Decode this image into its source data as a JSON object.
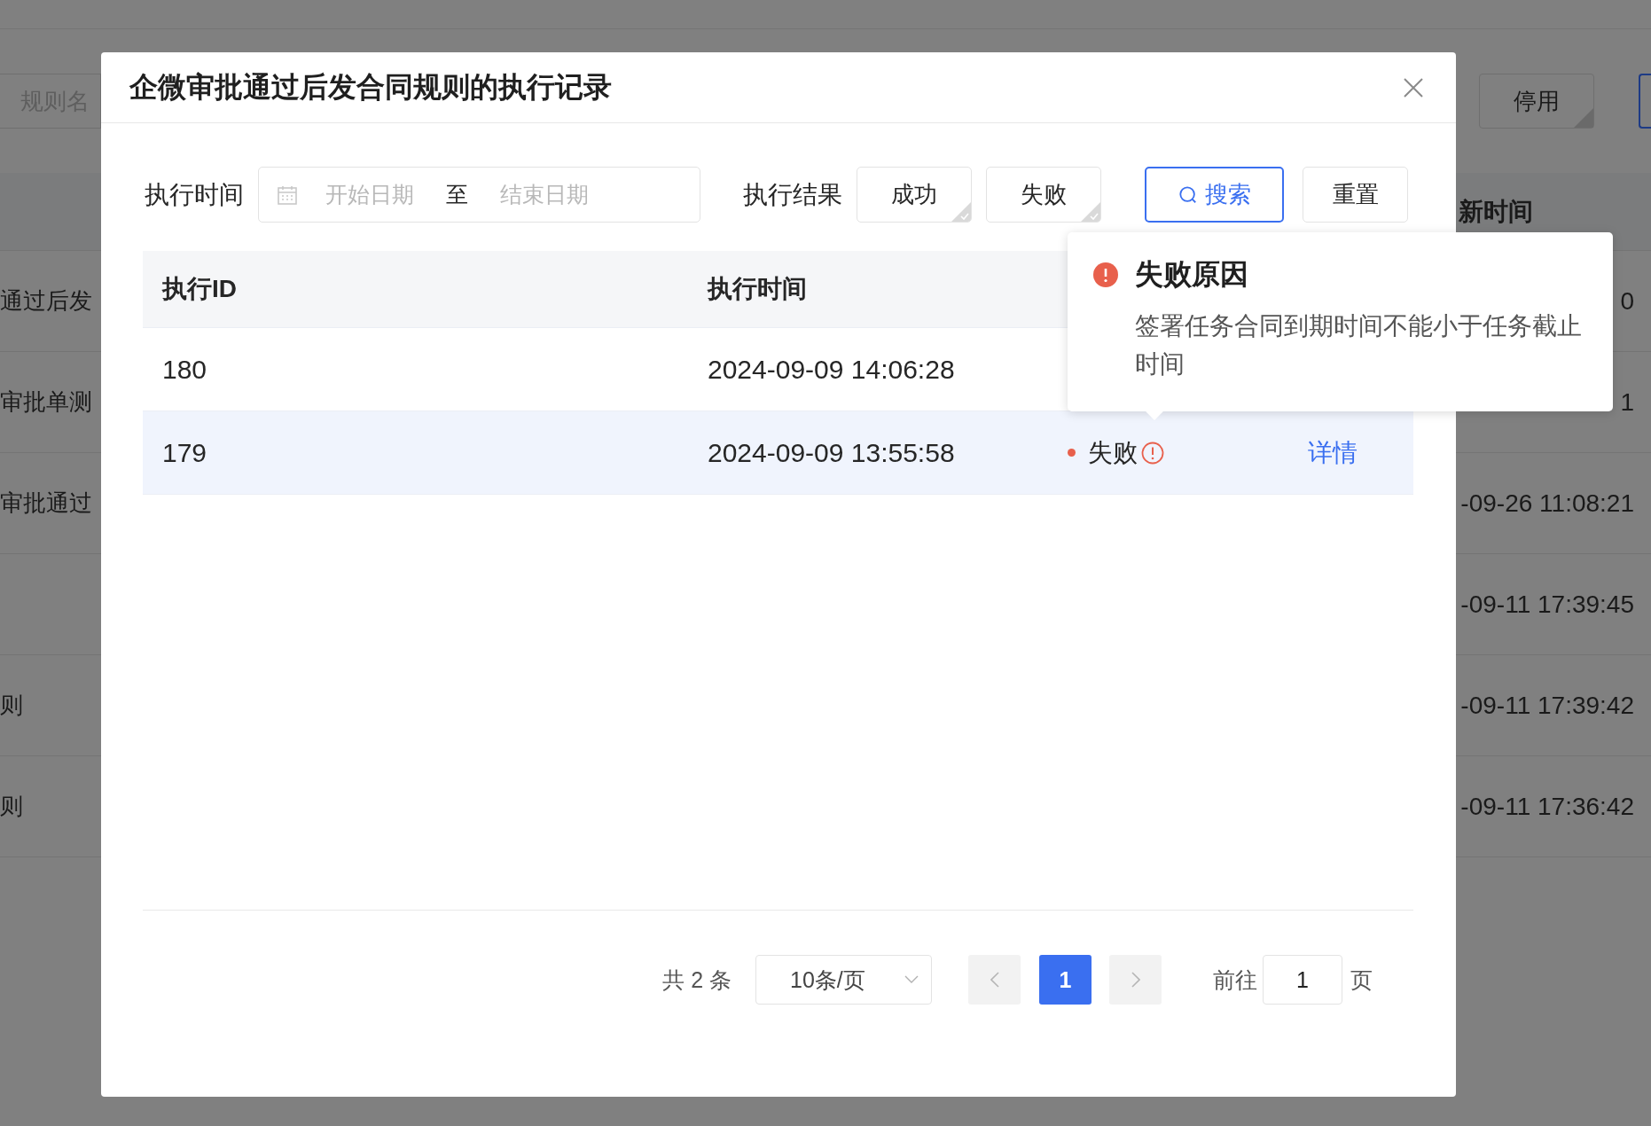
{
  "background_page": {
    "search_placeholder": "规则名",
    "buttons": [
      {
        "label": "停用",
        "kind": "default"
      },
      {
        "kind": "primary"
      }
    ],
    "table": {
      "column_header": "新时间",
      "rows": [
        {
          "column_1": "通过后发",
          "column_2": "0"
        },
        {
          "column_1": "审批单测",
          "column_2": "1"
        },
        {
          "column_1": "审批通过",
          "column_2": "-09-26 11:08:21"
        },
        {
          "column_1": "",
          "column_2": "-09-11 17:39:45"
        },
        {
          "column_1": "则",
          "column_2": "-09-11 17:39:42"
        },
        {
          "column_1": "则",
          "column_2": "-09-11 17:36:42"
        }
      ]
    }
  },
  "dialog": {
    "title": "企微审批通过后发合同规则的执行记录",
    "filters": {
      "time_label": "执行时间",
      "date_range": {
        "start_placeholder": "开始日期",
        "separator": "至",
        "end_placeholder": "结束日期"
      },
      "result_label": "执行结果",
      "result_options": [
        {
          "label": "成功",
          "selected": false
        },
        {
          "label": "失败",
          "selected": false
        }
      ],
      "search_button": "搜索",
      "reset_button": "重置"
    },
    "table": {
      "columns": [
        "执行ID",
        "执行时间"
      ],
      "rows": [
        {
          "id": "180",
          "time": "2024-09-09 14:06:28",
          "hovered": false
        },
        {
          "id": "179",
          "time": "2024-09-09 13:55:58",
          "hovered": true,
          "status": {
            "kind": "failure",
            "label": "失败"
          },
          "action": "详情"
        }
      ]
    },
    "pagination": {
      "total": "共 2 条",
      "page_size": "10条/页",
      "pages": [
        {
          "label": "1",
          "selected": true
        }
      ],
      "goto_label": "前往",
      "goto_value": "1",
      "goto_suffix": "页"
    }
  },
  "tooltip": {
    "title": "失败原因",
    "message": "签署任务合同到期时间不能小于任务截止时间"
  }
}
